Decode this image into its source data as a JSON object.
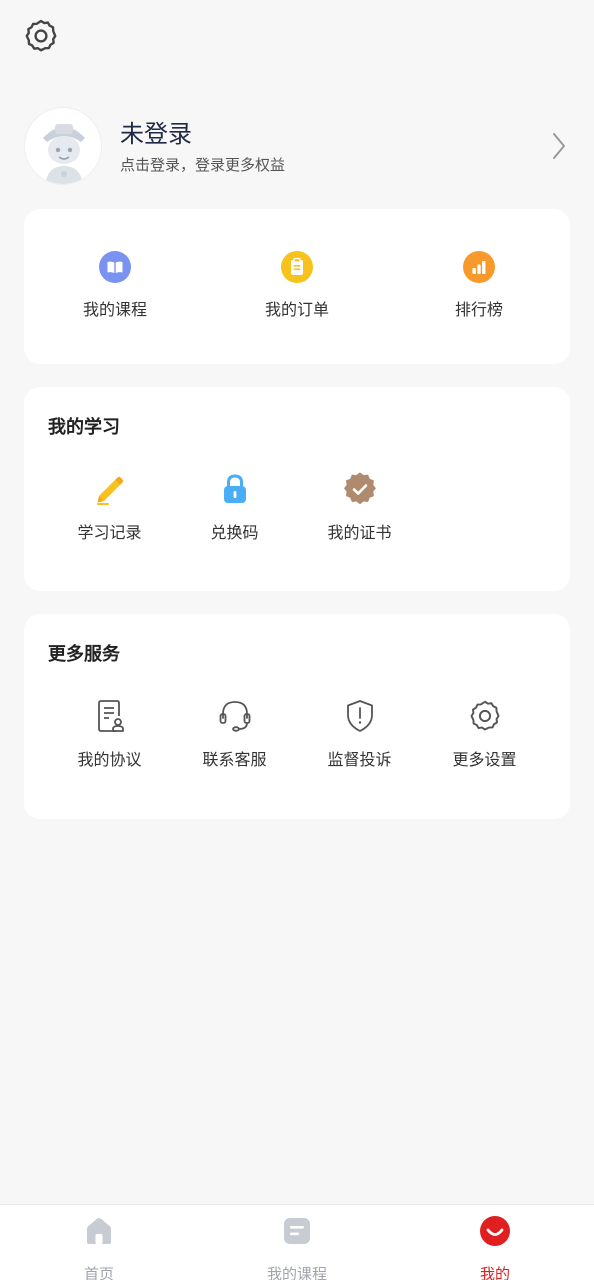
{
  "profile": {
    "name": "未登录",
    "subtitle": "点击登录，登录更多权益"
  },
  "quick_actions": [
    {
      "label": "我的课程",
      "icon": "book-icon",
      "color": "#7b93f0"
    },
    {
      "label": "我的订单",
      "icon": "clipboard-icon",
      "color": "#f6c21b"
    },
    {
      "label": "排行榜",
      "icon": "bar-chart-icon",
      "color": "#f79a2b"
    }
  ],
  "my_study": {
    "title": "我的学习",
    "items": [
      {
        "label": "学习记录",
        "icon": "pencil-icon",
        "color": "#f6c21b"
      },
      {
        "label": "兑换码",
        "icon": "lock-icon",
        "color": "#49aef5"
      },
      {
        "label": "我的证书",
        "icon": "badge-check-icon",
        "color": "#b08a6e"
      }
    ]
  },
  "more_services": {
    "title": "更多服务",
    "items": [
      {
        "label": "我的协议",
        "icon": "document-icon"
      },
      {
        "label": "联系客服",
        "icon": "headset-icon"
      },
      {
        "label": "监督投诉",
        "icon": "shield-alert-icon"
      },
      {
        "label": "更多设置",
        "icon": "gear-icon"
      }
    ]
  },
  "tabbar": [
    {
      "label": "首页",
      "icon": "home-icon",
      "active": false
    },
    {
      "label": "我的课程",
      "icon": "course-icon",
      "active": false
    },
    {
      "label": "我的",
      "icon": "smile-icon",
      "active": true
    }
  ],
  "colors": {
    "accent": "#e02020",
    "inactive": "#a0a4ab",
    "background": "#f7f7f8"
  }
}
